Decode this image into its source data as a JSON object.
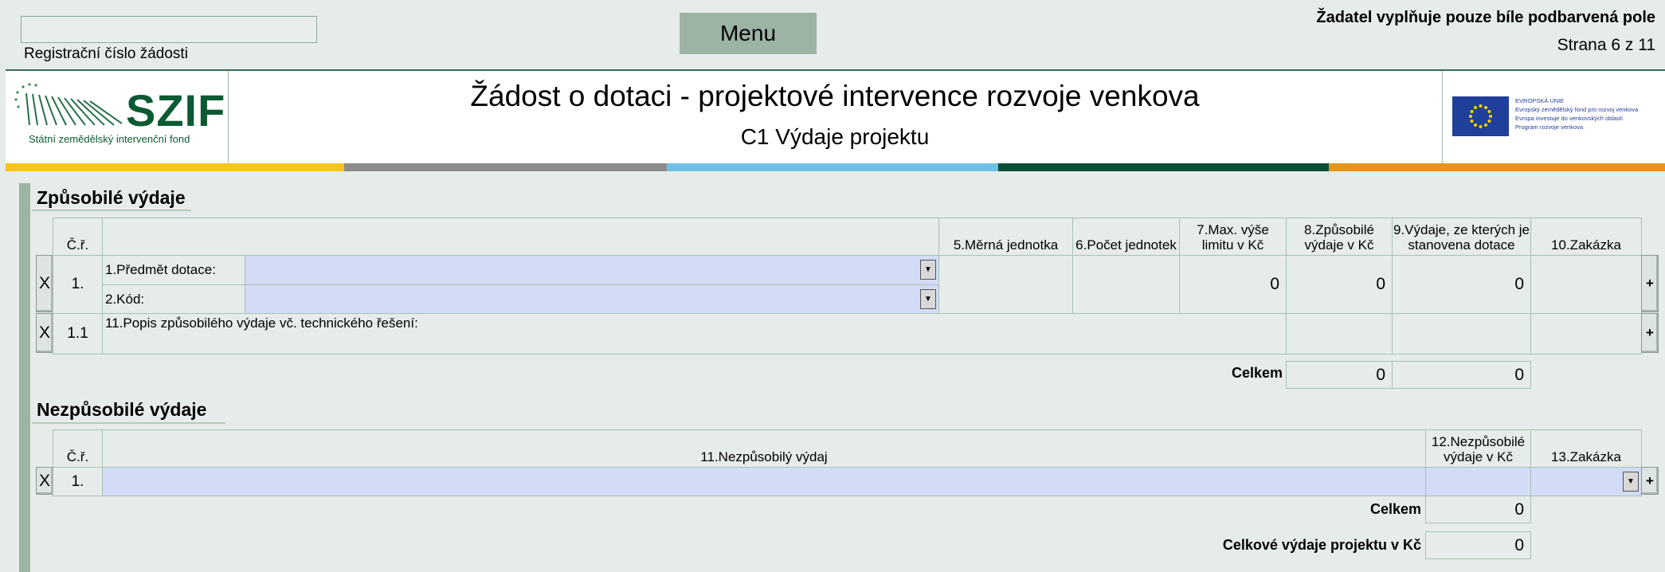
{
  "header": {
    "registration_label": "Registrační číslo žádosti",
    "menu_label": "Menu",
    "note": "Žadatel vyplňuje pouze bíle podbarvená pole",
    "page": "Strana 6 z 11",
    "title": "Žádost o dotaci - projektové intervence rozvoje venkova",
    "subtitle": "C1 Výdaje projektu",
    "logo_text": "SZIF",
    "logo_subtitle": "Státní zemědělský intervenční fond",
    "eu_text": "EVROPSKÁ UNIE\nEvropský zemědělský fond pro rozvoj venkova\nEvropa investuje do venkovských oblastí\nProgram rozvoje venkova",
    "stripe_colors": [
      "#f5c518",
      "#8c8c8c",
      "#6ec1e4",
      "#0a4d35",
      "#e6951b"
    ]
  },
  "eligible": {
    "section_title": "Způsobilé výdaje",
    "columns": {
      "cr": "Č.ř.",
      "unit": "5.Měrná jednotka",
      "count": "6.Počet jednotek",
      "max": "7.Max. výše limitu v Kč",
      "eligible": "8.Způsobilé výdaje v Kč",
      "basis": "9.Výdaje, ze kterých je stanovena dotace",
      "contract": "10.Zakázka"
    },
    "row1": {
      "delete": "X",
      "number": "1.",
      "subject_label": "1.Předmět dotace:",
      "code_label": "2.Kód:",
      "max_value": "0",
      "eligible_value": "0",
      "basis_value": "0",
      "add": "+"
    },
    "row11": {
      "delete": "X",
      "number": "1.1",
      "description_label": "11.Popis způsobilého výdaje vč. technického řešení:",
      "add": "+"
    },
    "total_label": "Celkem",
    "total_eligible": "0",
    "total_basis": "0"
  },
  "ineligible": {
    "section_title": "Nezpůsobilé výdaje",
    "columns": {
      "cr": "Č.ř.",
      "expense": "11.Nezpůsobilý výdaj",
      "amount": "12.Nezpůsobilé výdaje v Kč",
      "contract": "13.Zakázka"
    },
    "row1": {
      "delete": "X",
      "number": "1.",
      "add": "+"
    },
    "total_label": "Celkem",
    "total_value": "0",
    "project_total_label": "Celkové výdaje projektu v Kč",
    "project_total_value": "0"
  }
}
